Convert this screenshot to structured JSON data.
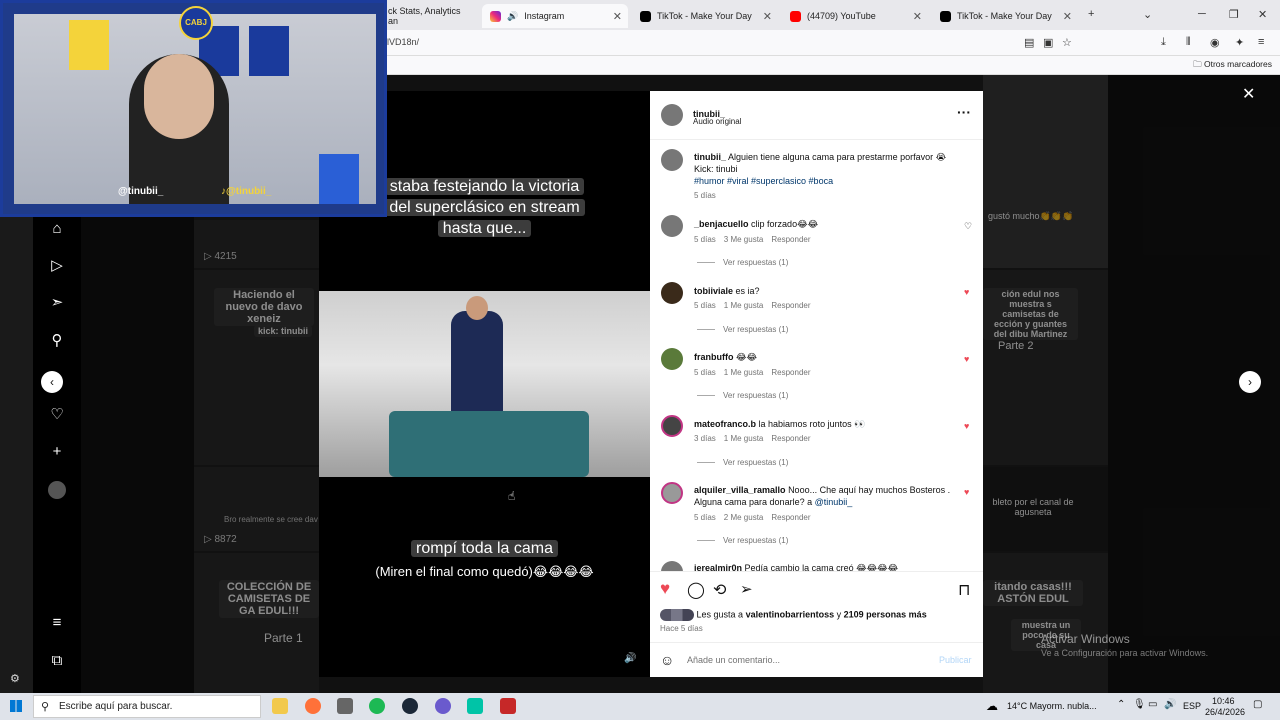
{
  "browser": {
    "tabs": [
      {
        "label": "ck Stats, Analytics an",
        "active": false
      },
      {
        "label": "Instagram",
        "active": true
      },
      {
        "label": "TikTok - Make Your Day",
        "active": false
      },
      {
        "label": "(44709) YouTube",
        "active": false
      },
      {
        "label": "TikTok - Make Your Day",
        "active": false
      }
    ],
    "url": "lVD18n/",
    "bookmarks_folder": "Otros marcadores"
  },
  "grid": {
    "tiles": [
      {
        "caption": "Haciendo el nuevo de davo xeneiz",
        "sub": "kick: tinubii",
        "views": ""
      },
      {
        "caption": "",
        "sub": "Bro realmente se cree dav",
        "views": "8872"
      },
      {
        "caption": "COLECCIÓN DE CAMISETAS DE GA EDUL!!!",
        "sub": "Parte 1",
        "views": ""
      },
      {
        "caption": "",
        "sub": "",
        "views": "4215"
      },
      {
        "caption": "gustó mucho👏👏👏",
        "sub": "",
        "views": ""
      },
      {
        "caption": "ción edul nos muestra s camisetas de ección y guantes del dibu Martinez",
        "sub": "Parte 2",
        "views": ""
      },
      {
        "caption": "bleto por el canal de agusneta",
        "sub": "",
        "views": ""
      },
      {
        "caption": "itando casas!!! ASTÓN EDUL",
        "sub": "muestra un poco de su casa",
        "views": ""
      }
    ]
  },
  "reel": {
    "top_text": [
      "staba festejando la victoria",
      "del superclásico en stream",
      "hasta que..."
    ],
    "bottom_text": [
      "rompí toda la cama",
      "(Miren el final como quedó)😂😂😂😂"
    ]
  },
  "post": {
    "author": "tinubii_",
    "audio": "Audio original",
    "caption_user": "tinubii_",
    "caption_text": "Alguien tiene alguna cama para prestarme porfavor 😭",
    "caption_kick": "Kick: tinubi",
    "caption_tags": "#humor #viral #superclasico #boca",
    "caption_time": "5 días",
    "comments": [
      {
        "user": "_benjacuello",
        "text": "clip forzado😂😂",
        "time": "5 días",
        "likes": "3 Me gusta",
        "reply": "Responder",
        "replies": "Ver respuestas (1)"
      },
      {
        "user": "tobiiviale",
        "text": "es ia?",
        "time": "5 días",
        "likes": "1 Me gusta",
        "reply": "Responder",
        "replies": "Ver respuestas (1)"
      },
      {
        "user": "franbuffo",
        "text": "😂😂",
        "time": "5 días",
        "likes": "1 Me gusta",
        "reply": "Responder",
        "replies": "Ver respuestas (1)"
      },
      {
        "user": "mateofranco.b",
        "text": "la habiamos roto juntos 👀",
        "time": "3 días",
        "likes": "1 Me gusta",
        "reply": "Responder",
        "replies": "Ver respuestas (1)"
      },
      {
        "user": "alquiler_villa_ramallo",
        "text": "Nooo... Che aquí hay muchos Bosteros . Alguna cama para donarle? a",
        "mention": "@tinubii_",
        "time": "5 días",
        "likes": "2 Me gusta",
        "reply": "Responder",
        "replies": "Ver respuestas (1)"
      },
      {
        "user": "jerealmir0n",
        "text": "Pedía cambio la cama creó 😂😂😂😂",
        "time": "",
        "likes": "",
        "reply": "",
        "replies": ""
      }
    ],
    "likes_prefix": "Les gusta a",
    "likes_user": "valentinobarrientoss",
    "likes_and": "y",
    "likes_count": "2109 personas más",
    "posted": "Hace 5 días",
    "comment_placeholder": "Añade un comentario...",
    "publish": "Publicar"
  },
  "webcam": {
    "handle_left": "@tinubii_",
    "handle_right": "@tinubii_",
    "badge": "CABJ"
  },
  "watermark": {
    "line1": "Activar Windows",
    "line2": "Ve a Configuración para activar Windows."
  },
  "taskbar": {
    "search_placeholder": "Escribe aquí para buscar.",
    "weather": "14°C  Mayorm. nubla...",
    "lang": "ESP",
    "time": "10:46",
    "date": "26/4/2026"
  }
}
